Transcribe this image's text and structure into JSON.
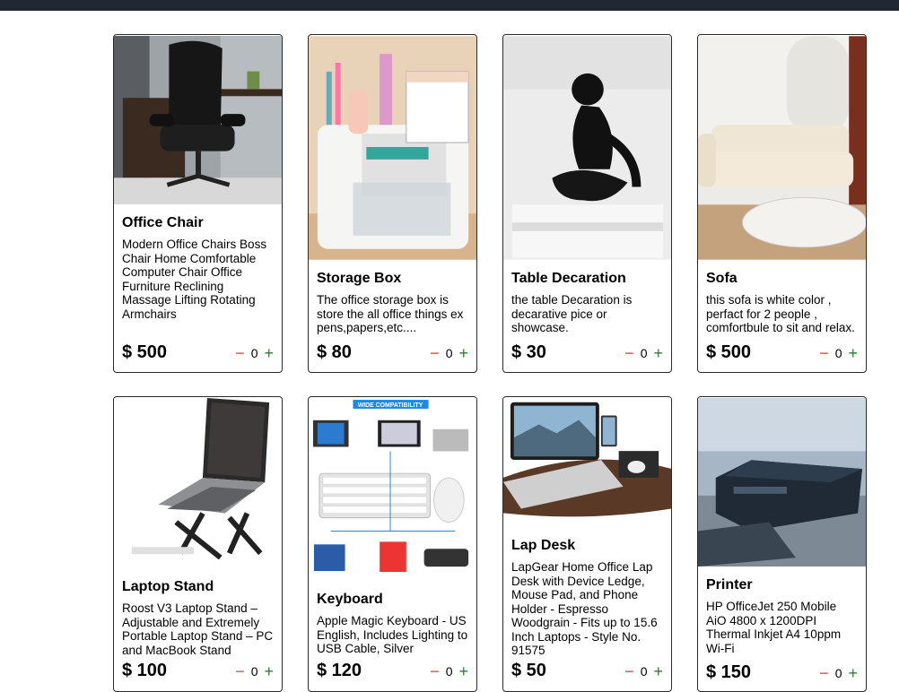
{
  "products": [
    {
      "title": "Office Chair",
      "description": "Modern Office Chairs Boss Chair Home Comfortable Computer Chair Office Furniture Reclining Massage Lifting Rotating Armchairs",
      "price": "$ 500",
      "qty": "0",
      "minus": "−",
      "plus": "+"
    },
    {
      "title": "Storage Box",
      "description": "The office storage box is store the all office things ex pens,papers,etc....",
      "price": "$ 80",
      "qty": "0",
      "minus": "−",
      "plus": "+"
    },
    {
      "title": "Table Decaration",
      "description": "the table Decaration is decarative pice or showcase.",
      "price": "$ 30",
      "qty": "0",
      "minus": "−",
      "plus": "+"
    },
    {
      "title": "Sofa",
      "description": "this sofa is white color , perfact for 2 people , comfortbule to sit and relax.",
      "price": "$ 500",
      "qty": "0",
      "minus": "−",
      "plus": "+"
    },
    {
      "title": "Laptop Stand",
      "description": "Roost V3 Laptop Stand – Adjustable and Extremely Portable Laptop Stand – PC and MacBook Stand",
      "price": "$ 100",
      "qty": "0",
      "minus": "−",
      "plus": "+"
    },
    {
      "title": "Keyboard",
      "description": "Apple Magic Keyboard - US English, Includes Lighting to USB Cable, Silver",
      "price": "$ 120",
      "qty": "0",
      "minus": "−",
      "plus": "+",
      "image_banner": "WIDE COMPATIBILITY"
    },
    {
      "title": "Lap Desk",
      "description": "LapGear Home Office Lap Desk with Device Ledge, Mouse Pad, and Phone Holder - Espresso Woodgrain - Fits up to 15.6 Inch Laptops - Style No. 91575",
      "price": "$ 50",
      "qty": "0",
      "minus": "−",
      "plus": "+"
    },
    {
      "title": "Printer",
      "description": "HP OfficeJet 250 Mobile AiO 4800 x 1200DPI Thermal Inkjet A4 10ppm Wi-Fi",
      "price": "$ 150",
      "qty": "0",
      "minus": "−",
      "plus": "+"
    }
  ],
  "colors": {
    "topbar": "#222831",
    "minus": "#e53935",
    "plus": "#2e7d32"
  }
}
